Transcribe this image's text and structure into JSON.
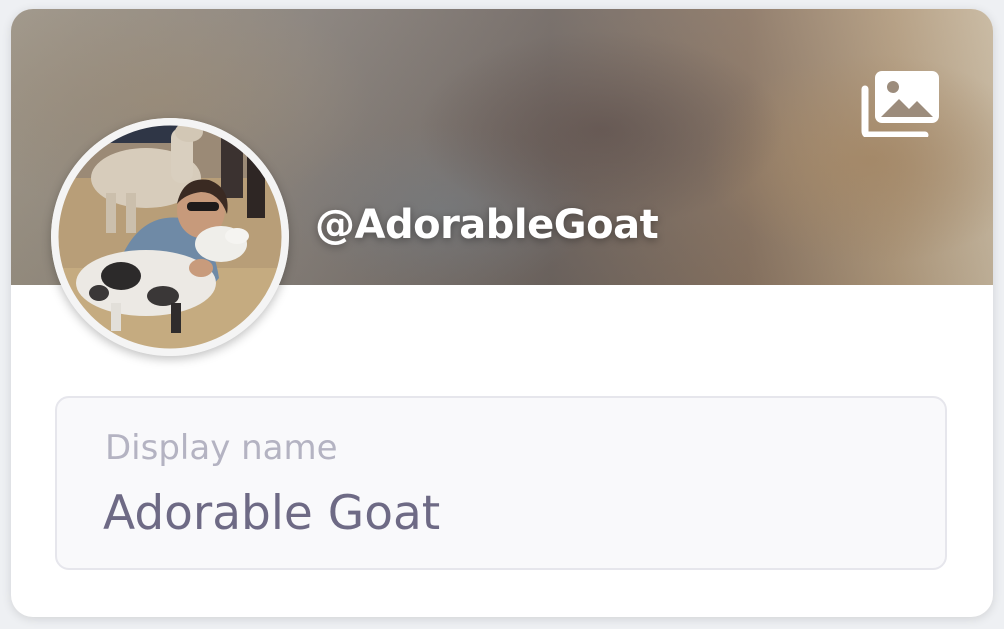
{
  "profile": {
    "handle": "@AdorableGoat",
    "avatar_alt": "Profile photo: person hugging a goat",
    "cover_button_icon": "image-gallery-icon"
  },
  "display_name_field": {
    "label": "Display name",
    "value": "Adorable Goat"
  },
  "colors": {
    "card_background": "#ffffff",
    "field_background": "#f9f9fb",
    "label_color": "#b4b3c2",
    "value_color": "#6e6a85",
    "handle_color": "#ffffff"
  }
}
